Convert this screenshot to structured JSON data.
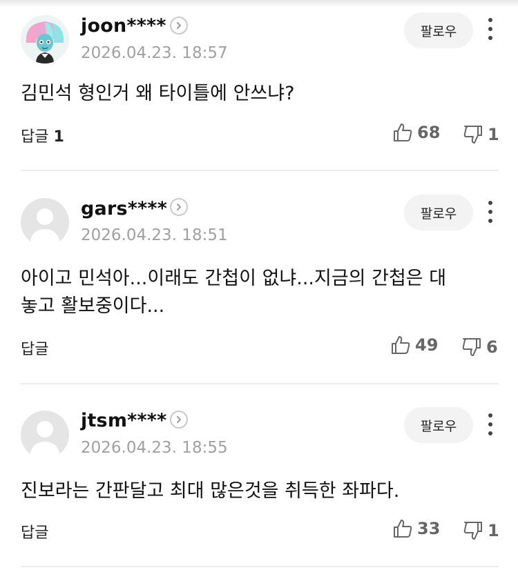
{
  "comments": [
    {
      "username": "joon****",
      "timestamp": "2026.04.23. 18:57",
      "follow_label": "팔로우",
      "text": "김민석 형인거 왜 타이틀에 안쓰냐?",
      "reply_label": "답글",
      "reply_count": "1",
      "likes": "68",
      "dislikes": "1",
      "avatar": "custom-character"
    },
    {
      "username": "gars****",
      "timestamp": "2026.04.23. 18:51",
      "follow_label": "팔로우",
      "text": "아이고 민석아...이래도 간첩이 없냐...지금의 간첩은 대놓고 활보중이다...",
      "reply_label": "답글",
      "reply_count": "",
      "likes": "49",
      "dislikes": "6",
      "avatar": "default-profile"
    },
    {
      "username": "jtsm****",
      "timestamp": "2026.04.23. 18:55",
      "follow_label": "팔로우",
      "text": "진보라는 간판달고 최대 많은것을 취득한 좌파다.",
      "reply_label": "답글",
      "reply_count": "",
      "likes": "33",
      "dislikes": "1",
      "avatar": "default-profile"
    }
  ],
  "icons": {
    "thumbs_up": "thumbs-up-icon",
    "thumbs_down": "thumbs-down-icon",
    "chevron": "chevron-right-icon",
    "more": "more-vertical-icon"
  },
  "colors": {
    "meta_gray": "#a0a0a0",
    "count_gray": "#666666",
    "button_bg": "#f3f3f3",
    "divider": "#ececec"
  }
}
